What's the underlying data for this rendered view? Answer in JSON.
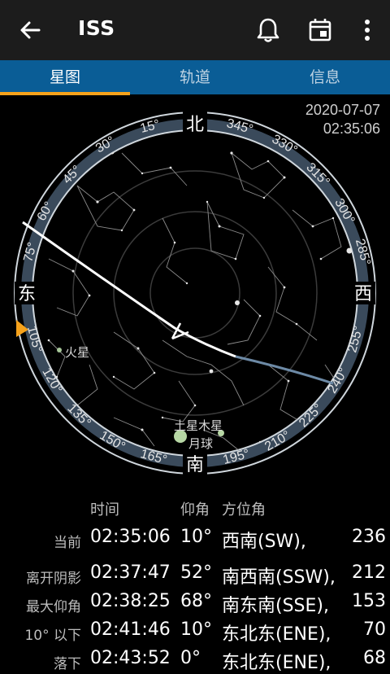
{
  "app_bar": {
    "title": "ISS",
    "back_icon": "arrow-left-icon",
    "actions": [
      "bell-icon",
      "calendar-icon",
      "more-vert-icon"
    ]
  },
  "tabs": [
    {
      "label": "星图",
      "selected": true
    },
    {
      "label": "轨道",
      "selected": false
    },
    {
      "label": "信息",
      "selected": false
    }
  ],
  "colors": {
    "tab_bar": "#0a5d96",
    "tab_indicator": "#f6a21b",
    "app_bar": "#1c1c1c",
    "ring": "#3a4a5b"
  },
  "sky_map": {
    "date": "2020-07-07",
    "time": "02:35:06",
    "cardinals": {
      "north": "北",
      "east": "东",
      "south": "南",
      "west": "西"
    },
    "bearings": [
      "15°",
      "30°",
      "45°",
      "60°",
      "75°",
      "105°",
      "120°",
      "135°",
      "150°",
      "165°",
      "195°",
      "210°",
      "225°",
      "240°",
      "255°",
      "285°",
      "300°",
      "315°",
      "330°",
      "345°"
    ],
    "planets": {
      "mars": "火星",
      "saturn_jupiter": "土星木星",
      "moon": "月球"
    }
  },
  "pass_table": {
    "headers": {
      "time": "时间",
      "elevation": "仰角",
      "azimuth": "方位角"
    },
    "rows": [
      {
        "label": "当前",
        "time": "02:35:06",
        "elev": "10°",
        "dir": "西南(SW),",
        "deg": "236"
      },
      {
        "label": "离开阴影",
        "time": "02:37:47",
        "elev": "52°",
        "dir": "南西南(SSW),",
        "deg": "212"
      },
      {
        "label": "最大仰角",
        "time": "02:38:25",
        "elev": "68°",
        "dir": "南东南(SSE),",
        "deg": "153"
      },
      {
        "label": "10° 以下",
        "time": "02:41:46",
        "elev": "10°",
        "dir": "东北东(ENE),",
        "deg": "70"
      },
      {
        "label": "落下",
        "time": "02:43:52",
        "elev": "0°",
        "dir": "东北东(ENE),",
        "deg": "68"
      }
    ]
  }
}
